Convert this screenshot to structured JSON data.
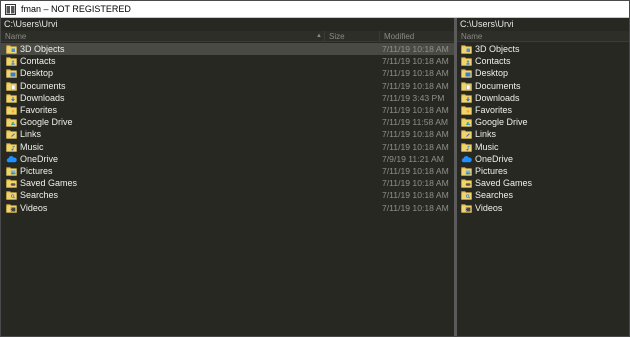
{
  "window": {
    "title": "fman – NOT REGISTERED"
  },
  "left_pane": {
    "path": "C:\\Users\\Urvi",
    "columns": {
      "name": "Name",
      "size": "Size",
      "modified": "Modified"
    },
    "sort_indicator": "▲",
    "rows": [
      {
        "name": "3D Objects",
        "modified": "7/11/19 10:18 AM",
        "icon": "folder-3d-icon",
        "selected": true
      },
      {
        "name": "Contacts",
        "modified": "7/11/19 10:18 AM",
        "icon": "folder-contacts-icon"
      },
      {
        "name": "Desktop",
        "modified": "7/11/19 10:18 AM",
        "icon": "folder-desktop-icon"
      },
      {
        "name": "Documents",
        "modified": "7/11/19 10:18 AM",
        "icon": "folder-documents-icon"
      },
      {
        "name": "Downloads",
        "modified": "7/11/19 3:43 PM",
        "icon": "folder-downloads-icon"
      },
      {
        "name": "Favorites",
        "modified": "7/11/19 10:18 AM",
        "icon": "folder-favorites-icon"
      },
      {
        "name": "Google Drive",
        "modified": "7/11/19 11:58 AM",
        "icon": "folder-google-drive-icon"
      },
      {
        "name": "Links",
        "modified": "7/11/19 10:18 AM",
        "icon": "folder-links-icon"
      },
      {
        "name": "Music",
        "modified": "7/11/19 10:18 AM",
        "icon": "folder-music-icon"
      },
      {
        "name": "OneDrive",
        "modified": "7/9/19 11:21 AM",
        "icon": "onedrive-cloud-icon"
      },
      {
        "name": "Pictures",
        "modified": "7/11/19 10:18 AM",
        "icon": "folder-pictures-icon"
      },
      {
        "name": "Saved Games",
        "modified": "7/11/19 10:18 AM",
        "icon": "folder-saved-games-icon"
      },
      {
        "name": "Searches",
        "modified": "7/11/19 10:18 AM",
        "icon": "folder-searches-icon"
      },
      {
        "name": "Videos",
        "modified": "7/11/19 10:18 AM",
        "icon": "folder-videos-icon"
      }
    ]
  },
  "right_pane": {
    "path": "C:\\Users\\Urvi",
    "columns": {
      "name": "Name"
    },
    "rows": [
      {
        "name": "3D Objects",
        "icon": "folder-3d-icon"
      },
      {
        "name": "Contacts",
        "icon": "folder-contacts-icon"
      },
      {
        "name": "Desktop",
        "icon": "folder-desktop-icon"
      },
      {
        "name": "Documents",
        "icon": "folder-documents-icon"
      },
      {
        "name": "Downloads",
        "icon": "folder-downloads-icon"
      },
      {
        "name": "Favorites",
        "icon": "folder-favorites-icon"
      },
      {
        "name": "Google Drive",
        "icon": "folder-google-drive-icon"
      },
      {
        "name": "Links",
        "icon": "folder-links-icon"
      },
      {
        "name": "Music",
        "icon": "folder-music-icon"
      },
      {
        "name": "OneDrive",
        "icon": "onedrive-cloud-icon"
      },
      {
        "name": "Pictures",
        "icon": "folder-pictures-icon"
      },
      {
        "name": "Saved Games",
        "icon": "folder-saved-games-icon"
      },
      {
        "name": "Searches",
        "icon": "folder-searches-icon"
      },
      {
        "name": "Videos",
        "icon": "folder-videos-icon"
      }
    ]
  },
  "colors": {
    "background": "#272822",
    "selected_row": "#4a4a44",
    "text": "#f0f0ea",
    "dim_text": "#8f9088",
    "folder_yellow": "#e8c65a",
    "onedrive_blue": "#1e90ff"
  }
}
